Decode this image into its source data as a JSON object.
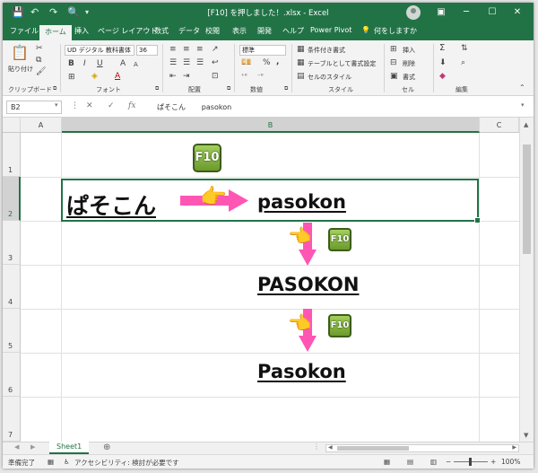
{
  "window": {
    "title": "[F10] を押しました！.xlsx  -  Excel",
    "quick_access": {
      "save": "💾",
      "undo": "↶",
      "redo": "↷",
      "preview": "🔍",
      "customize": "▾"
    },
    "controls": {
      "ribbon_display": "▣",
      "minimize": "─",
      "maximize": "☐",
      "close": "✕"
    }
  },
  "ribbon": {
    "tabs": [
      "ファイル",
      "ホーム",
      "挿入",
      "ページ レイアウト",
      "数式",
      "データ",
      "校閲",
      "表示",
      "開発",
      "ヘルプ",
      "Power Pivot"
    ],
    "active_tab": "ホーム",
    "tell_me": "何をしますか",
    "clipboard": {
      "label": "クリップボード",
      "paste": "貼り付け"
    },
    "font": {
      "label": "フォント",
      "name": "UD デジタル 教科書体",
      "size": "36",
      "bold": "B",
      "italic": "I",
      "underline": "U",
      "grow": "A",
      "shrink": "A"
    },
    "alignment": {
      "label": "配置"
    },
    "number": {
      "label": "数値",
      "format": "標準",
      "percent": "%",
      "comma": ","
    },
    "styles": {
      "label": "スタイル",
      "conditional": "条件付き書式",
      "as_table": "テーブルとして書式設定",
      "cell_styles": "セルのスタイル"
    },
    "cells": {
      "label": "セル",
      "insert": "挿入",
      "delete": "削除",
      "format": "書式"
    },
    "editing": {
      "label": "編集",
      "sum": "Σ"
    }
  },
  "formula_bar": {
    "name_box": "B2",
    "cancel": "✕",
    "enter": "✓",
    "fx": "fx",
    "value": "ぱそこん       pasokon"
  },
  "grid": {
    "columns": [
      "A",
      "B",
      "C"
    ],
    "rows": [
      "1",
      "2",
      "3",
      "4",
      "5",
      "6",
      "7"
    ],
    "selected_cell": "B2",
    "cell_content": {
      "input": "ぱそこん",
      "step1": "pasokon",
      "step2": "PASOKON",
      "step3": "Pasokon"
    },
    "key_label": "F10",
    "hand_right": "👉",
    "hand_left": "👈"
  },
  "sheets": {
    "tabs": [
      "Sheet1"
    ],
    "add": "⊕"
  },
  "status": {
    "ready": "準備完了",
    "accessibility": "アクセシビリティ: 検討が必要です",
    "zoom_minus": "−",
    "zoom_plus": "+",
    "zoom": "100%"
  },
  "colors": {
    "excel_green": "#217346",
    "arrow_pink": "#ff56b4",
    "key_green": "#8bbb45"
  }
}
